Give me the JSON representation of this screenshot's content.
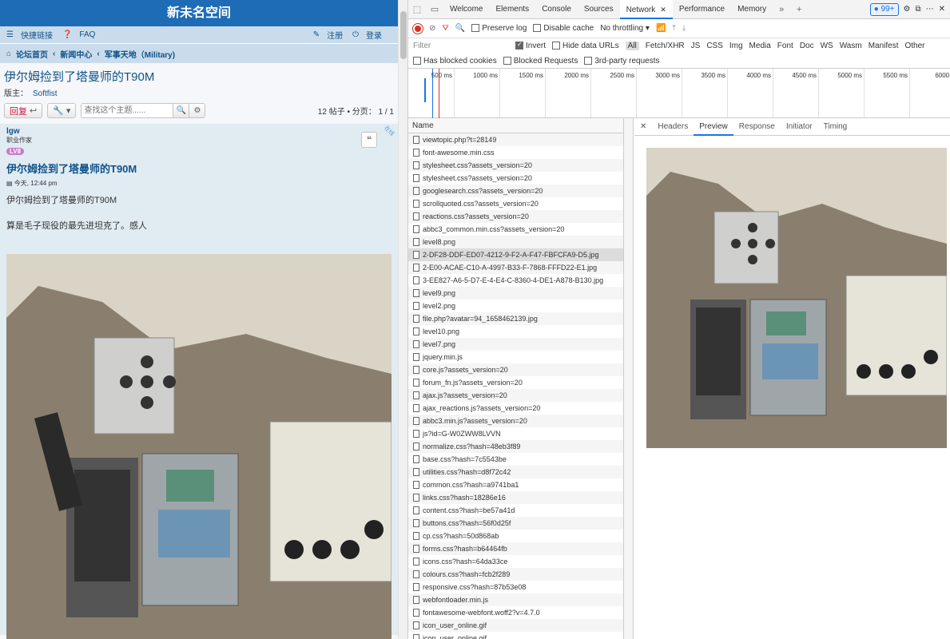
{
  "forum": {
    "site_title": "新未名空间",
    "nav": {
      "quick_links": "快捷链接",
      "faq": "FAQ",
      "register": "注册",
      "login": "登录"
    },
    "breadcrumbs": [
      "论坛首页",
      "新闻中心",
      "军事天地（Military)"
    ],
    "topic_title": "伊尔姆捡到了塔曼师的T90M",
    "moderator_label": "版主：",
    "moderator_name": "Softfist",
    "reply_button": "回复",
    "search_placeholder": "查找这个主题......",
    "pager": "12 帖子 • 分页： 1 / 1",
    "post": {
      "author": "lgw",
      "rank": "职业作家",
      "badge": "LV8",
      "online_tag": "在线",
      "title": "伊尔姆捡到了塔曼师的T90M",
      "date": "今天, 12:44 pm",
      "body_line1": "伊尔姆捡到了塔曼师的T90M",
      "body_line2": "算是毛子现役的最先进坦克了。感人"
    }
  },
  "devtools": {
    "tabs": [
      "Welcome",
      "Elements",
      "Console",
      "Sources",
      "Network",
      "Performance",
      "Memory"
    ],
    "active_tab": "Network",
    "issues_count": "99+",
    "toolbar": {
      "preserve_log": "Preserve log",
      "disable_cache": "Disable cache",
      "throttling": "No throttling"
    },
    "filter": {
      "placeholder": "Filter",
      "invert": "Invert",
      "hide_data_urls": "Hide data URLs",
      "types": [
        "All",
        "Fetch/XHR",
        "JS",
        "CSS",
        "Img",
        "Media",
        "Font",
        "Doc",
        "WS",
        "Wasm",
        "Manifest",
        "Other"
      ],
      "has_blocked_cookies": "Has blocked cookies",
      "blocked_requests": "Blocked Requests",
      "third_party": "3rd-party requests"
    },
    "timeline_ticks": [
      "500 ms",
      "1000 ms",
      "1500 ms",
      "2000 ms",
      "2500 ms",
      "3000 ms",
      "3500 ms",
      "4000 ms",
      "4500 ms",
      "5000 ms",
      "5500 ms",
      "6000 r"
    ],
    "name_header": "Name",
    "requests": [
      "viewtopic.php?t=28149",
      "font-awesome.min.css",
      "stylesheet.css?assets_version=20",
      "stylesheet.css?assets_version=20",
      "googlesearch.css?assets_version=20",
      "scrollquoted.css?assets_version=20",
      "reactions.css?assets_version=20",
      "abbc3_common.min.css?assets_version=20",
      "level8.png",
      "2-DF28-DDF-ED07-4212-9-F2-A-F47-FBFCFA9-D5.jpg",
      "2-E00-ACAE-C10-A-4997-B33-F-7868-FFFD22-E1.jpg",
      "3-EE827-A6-5-D7-E-4-E4-C-8360-4-DE1-A878-B130.jpg",
      "level9.png",
      "level2.png",
      "file.php?avatar=94_1658462139.jpg",
      "level10.png",
      "level7.png",
      "jquery.min.js",
      "core.js?assets_version=20",
      "forum_fn.js?assets_version=20",
      "ajax.js?assets_version=20",
      "ajax_reactions.js?assets_version=20",
      "abbc3.min.js?assets_version=20",
      "js?id=G-W0ZWW8LVVN",
      "normalize.css?hash=48eb3f89",
      "base.css?hash=7c5543be",
      "utilities.css?hash=d8f72c42",
      "common.css?hash=a9741ba1",
      "links.css?hash=18286e16",
      "content.css?hash=be57a41d",
      "buttons.css?hash=56f0d25f",
      "cp.css?hash=50d868ab",
      "forms.css?hash=b64464fb",
      "icons.css?hash=64da33ce",
      "colours.css?hash=fcb2f289",
      "responsive.css?hash=87b53e08",
      "webfontloader.min.js",
      "fontawesome-webfont.woff2?v=4.7.0",
      "icon_user_online.gif",
      "icon_user_online.gif"
    ],
    "detail_tabs": [
      "Headers",
      "Preview",
      "Response",
      "Initiator",
      "Timing"
    ],
    "active_detail_tab": "Preview"
  }
}
